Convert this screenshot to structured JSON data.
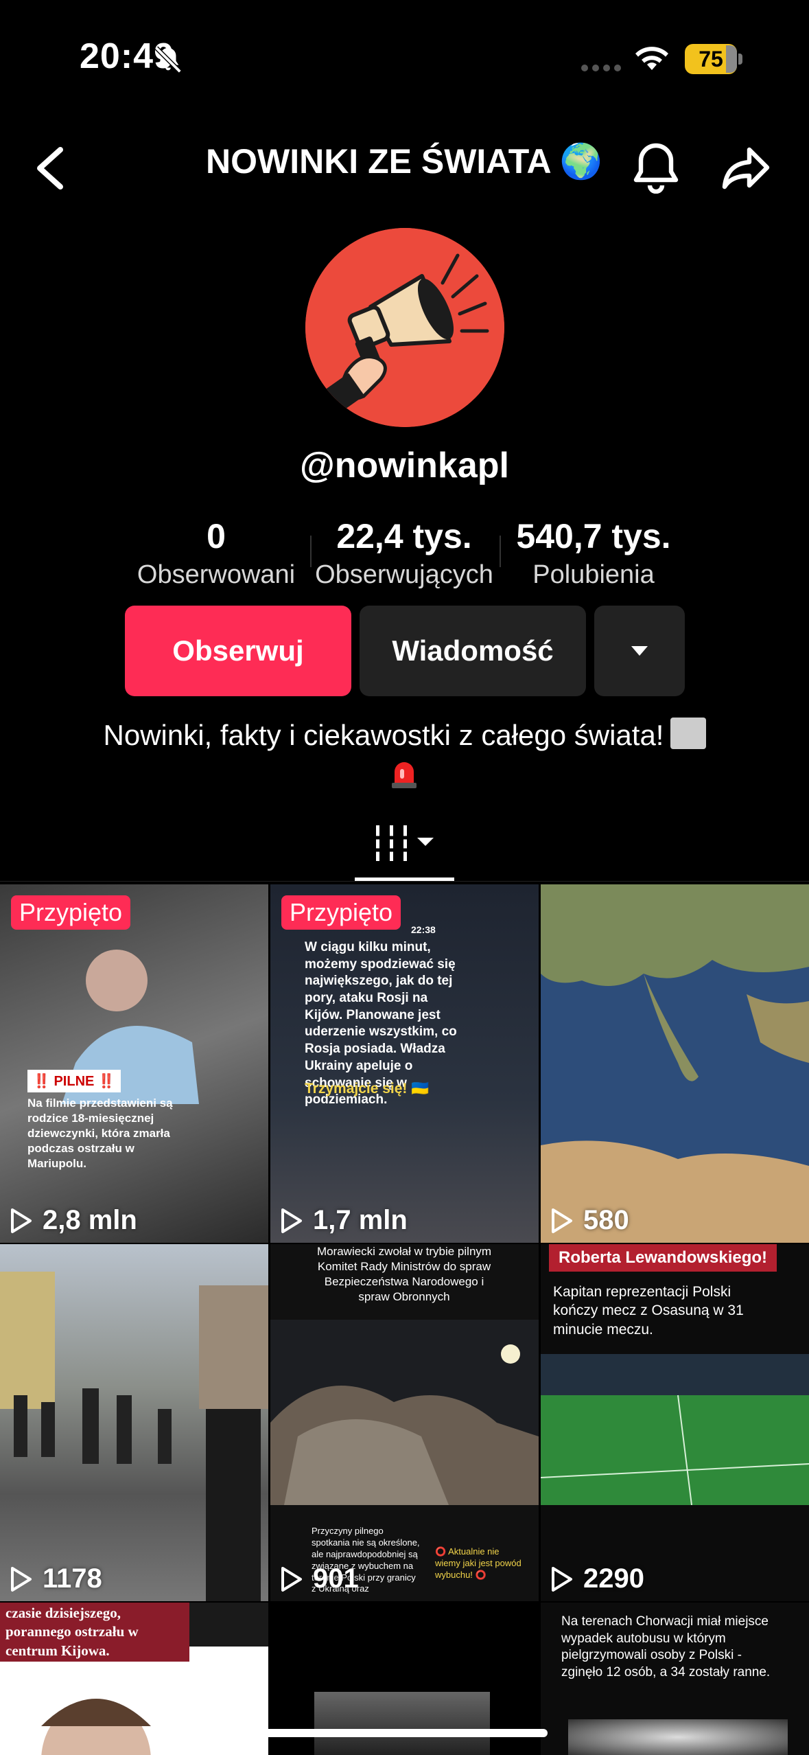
{
  "status_bar": {
    "time": "20:49",
    "battery": "75"
  },
  "header": {
    "title": "NOWINKI ZE ŚWIATA 🌍"
  },
  "profile": {
    "handle": "@nowinkapl",
    "stats": [
      {
        "value": "0",
        "label": "Obserwowani"
      },
      {
        "value": "22,4 tys.",
        "label": "Obserwujących"
      },
      {
        "value": "540,7 tys.",
        "label": "Polubienia"
      }
    ],
    "follow_label": "Obserwuj",
    "message_label": "Wiadomość",
    "bio": "Nowinki, fakty i ciekawostki z całego świata!"
  },
  "videos": [
    {
      "pinned": "Przypięto",
      "views": "2,8 mln",
      "badge": "‼️ PILNE ‼️",
      "caption": "Na filmie przedstawieni są rodzice 18-miesięcznej dziewczynki, która zmarła podczas ostrzału w Mariupolu."
    },
    {
      "pinned": "Przypięto",
      "views": "1,7 mln",
      "time": "22:38",
      "caption": "W ciągu kilku minut, możemy spodziewać się największego, jak do tej pory, ataku Rosji na Kijów. Planowane jest uderzenie wszystkim, co Rosja posiada. Władza Ukrainy apeluje o schowanie się w podziemiach.",
      "caption2": "Trzymajcie się! 🇺🇦"
    },
    {
      "views": "580"
    },
    {
      "views": "1178"
    },
    {
      "views": "901",
      "caption": "Morawiecki zwołał w trybie pilnym Komitet Rady Ministrów do spraw Bezpieczeństwa Narodowego i spraw Obronnych",
      "caption_bottom_left": "Przyczyny pilnego spotkania nie są określone, ale najprawdopodobniej są związane z wybuchem na terenie Polski przy granicy z Ukrainą oraz",
      "caption_bottom_right": "⭕ Aktualnie nie wiemy jaki jest powód wybuchu! ⭕"
    },
    {
      "views": "2290",
      "banner": "Roberta Lewandowskiego!",
      "caption": "Kapitan reprezentacji Polski kończy mecz z Osasuną w 31 minucie meczu."
    },
    {
      "caption": "czasie dzisiejszego, porannego ostrzału w centrum Kijowa."
    },
    {},
    {
      "caption": "Na terenach Chorwacji miał miejsce wypadek autobusu w którym pielgrzymowali osoby z Polski - zginęło 12 osób, a 34 zostały ranne."
    }
  ]
}
